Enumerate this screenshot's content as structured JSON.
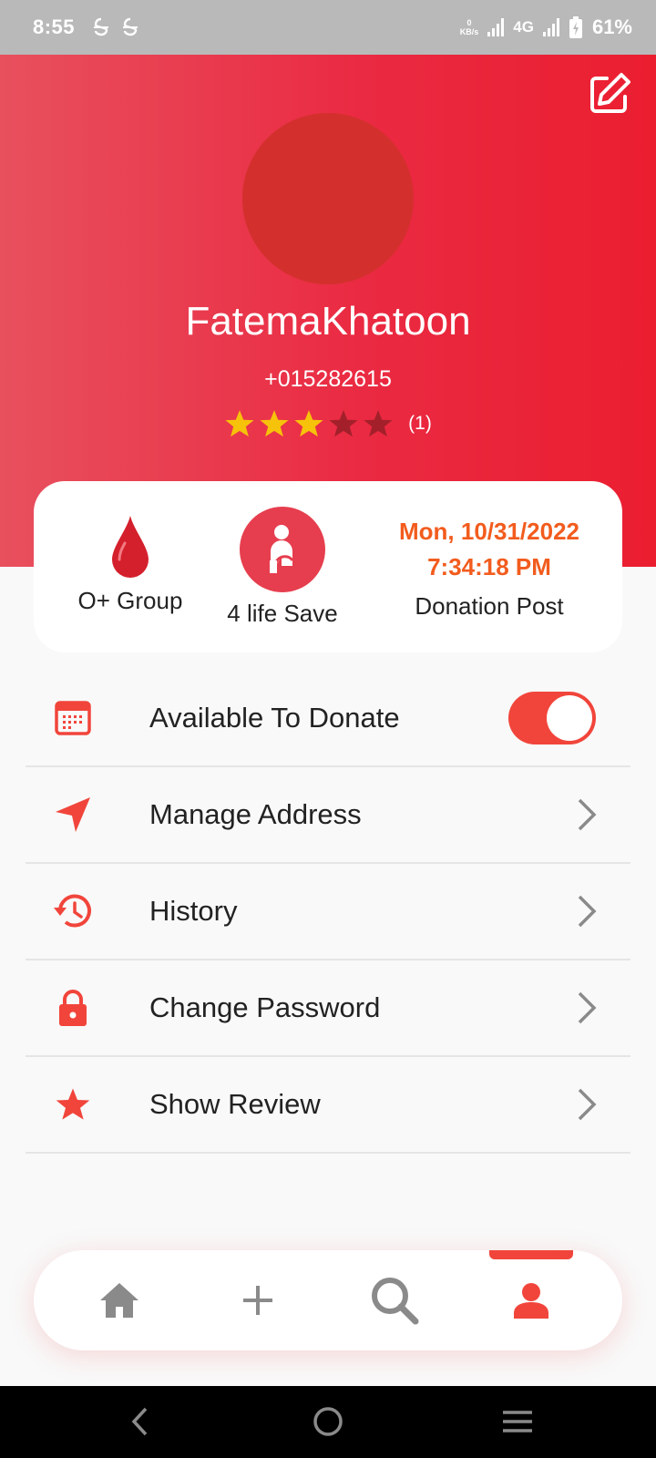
{
  "status_bar": {
    "time": "8:55",
    "data_rate_value": "0",
    "data_rate_unit": "KB/s",
    "network": "4G",
    "battery": "61%"
  },
  "profile": {
    "name": "FatemaKhatoon",
    "phone": "+015282615",
    "rating": 3,
    "rating_max": 5,
    "rating_count": "(1)"
  },
  "stats": {
    "blood_group_label": "O+ Group",
    "life_save_label": "4 life Save",
    "post_date_line1": "Mon, 10/31/2022",
    "post_date_line2": "7:34:18 PM",
    "post_label": "Donation Post"
  },
  "menu": {
    "available_label": "Available To Donate",
    "available_on": true,
    "items": [
      {
        "label": "Manage Address"
      },
      {
        "label": "History"
      },
      {
        "label": "Change Password"
      },
      {
        "label": "Show Review"
      }
    ]
  },
  "bottom_nav": {
    "items": [
      "home-icon",
      "add-icon",
      "search-icon",
      "profile-icon"
    ],
    "active": "profile-icon"
  },
  "colors": {
    "accent": "#f1453b",
    "header_start": "#e8505e",
    "header_end": "#eb1e30",
    "star_filled": "#f7c20a",
    "star_empty": "#a3202a",
    "date_orange": "#f25c1e"
  }
}
